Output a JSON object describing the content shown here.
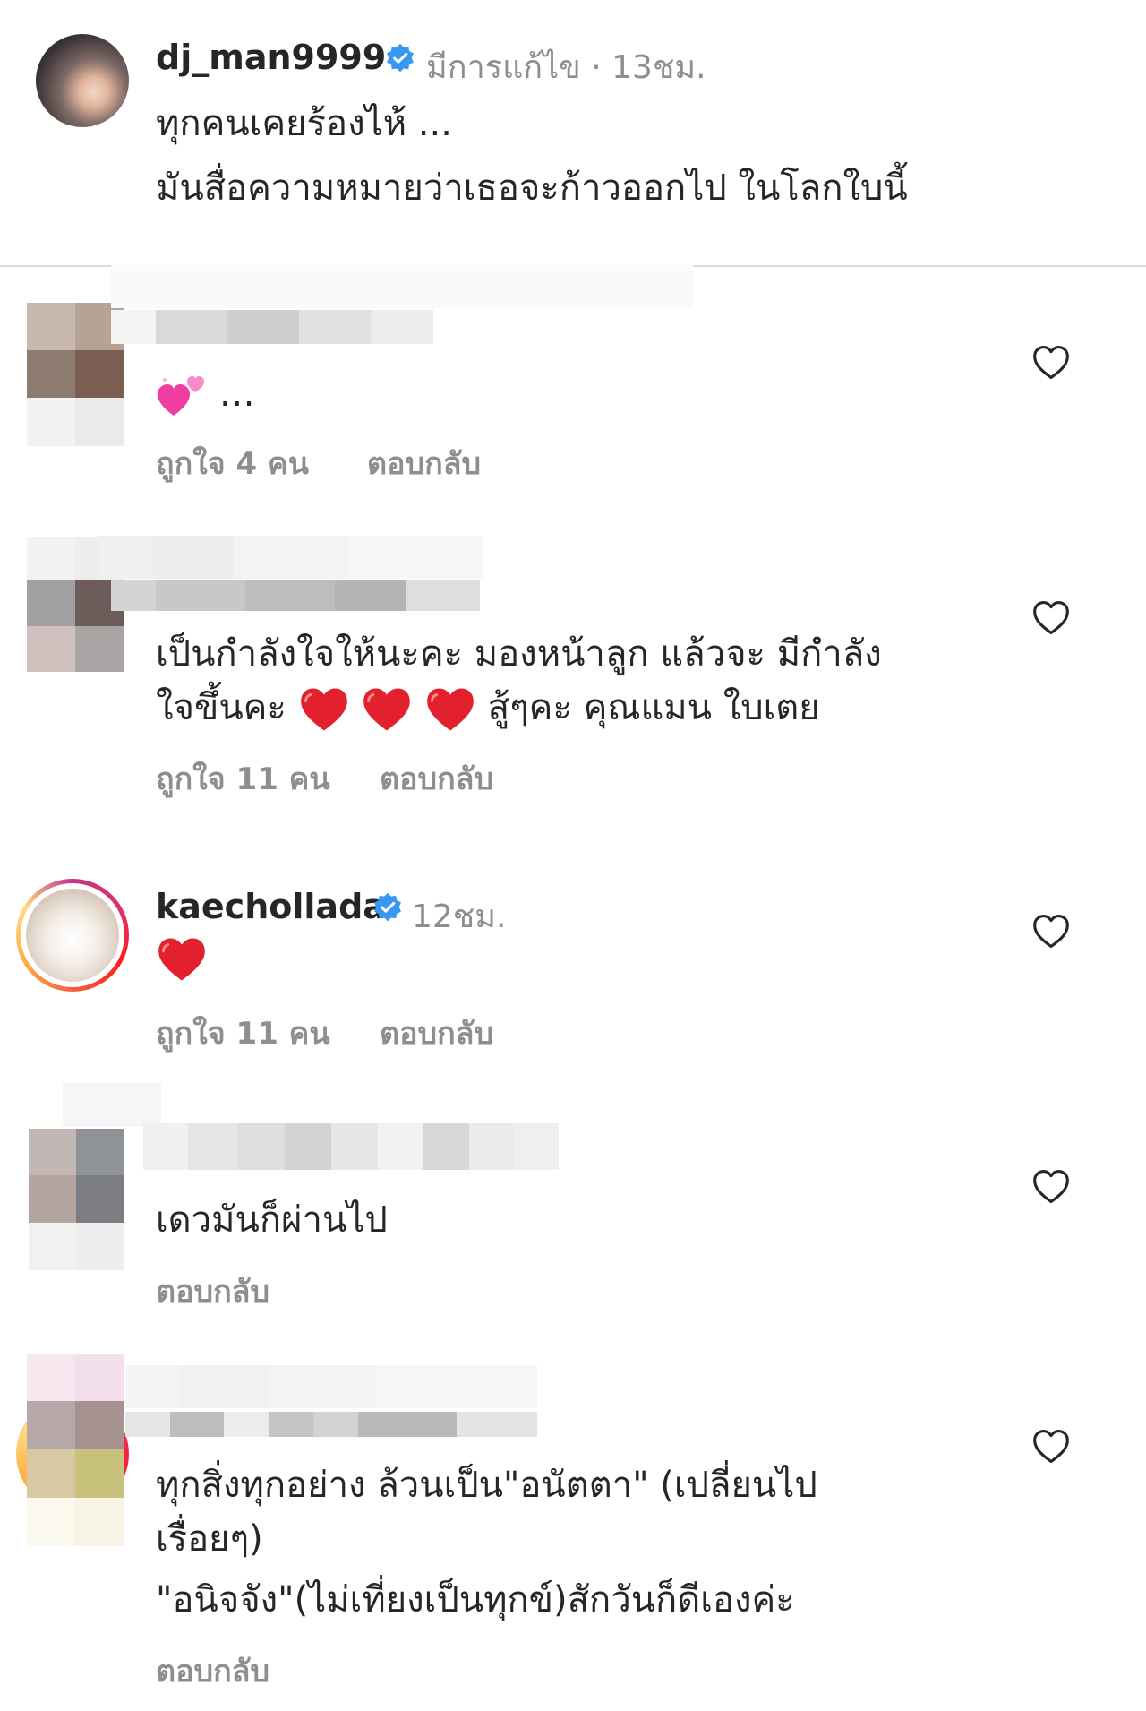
{
  "post": {
    "username": "dj_man9999",
    "edited_label": "มีการแก้ไข",
    "dot": "·",
    "time": "13ชม.",
    "caption_line1": "ทุกคนเคยร้องไห้ ...",
    "caption_line2": "มันสื่อความหมายว่าเธอจะก้าวออกไป ในโลกใบนี้"
  },
  "comments": [
    {
      "username": "",
      "text": "…",
      "emoji": "sparkling-hearts",
      "likes": "ถูกใจ 4 คน",
      "reply": "ตอบกลับ"
    },
    {
      "username": "",
      "text_line1": "เป็นกำลังใจให้นะคะ มองหน้าลูก แล้วจะ มีกำลัง",
      "text_line2_pre": "ใจขึ้นคะ",
      "text_line2_post": "สู้ๆคะ คุณแมน ใบเตย",
      "likes": "ถูกใจ 11 คน",
      "reply": "ตอบกลับ"
    },
    {
      "username": "kaechollada",
      "time": "12ชม.",
      "likes": "ถูกใจ 11 คน",
      "reply": "ตอบกลับ"
    },
    {
      "username": "",
      "text": "เดวมันก็ผ่านไป",
      "reply": "ตอบกลับ"
    },
    {
      "username": "",
      "text_line1": "ทุกสิ่งทุกอย่าง ล้วนเป็น\"อนัตตา\" (เปลี่ยนไป",
      "text_line2": "เรื่อยๆ)",
      "text_line3": "\"อนิจจัง\"(ไม่เที่ยงเป็นทุกข์)สักวันก็ดีเองค่ะ",
      "reply": "ตอบกลับ"
    }
  ],
  "colors": {
    "text": "#262626",
    "secondary": "#8e8e8e",
    "verified": "#3897f0",
    "heart_red": "#ed4956",
    "divider": "#dbdbdb"
  },
  "icons": {
    "verified": "verified-badge-icon",
    "like": "heart-outline-icon",
    "red_heart": "red-heart-emoji",
    "sparkling_hearts": "sparkling-hearts-emoji"
  }
}
